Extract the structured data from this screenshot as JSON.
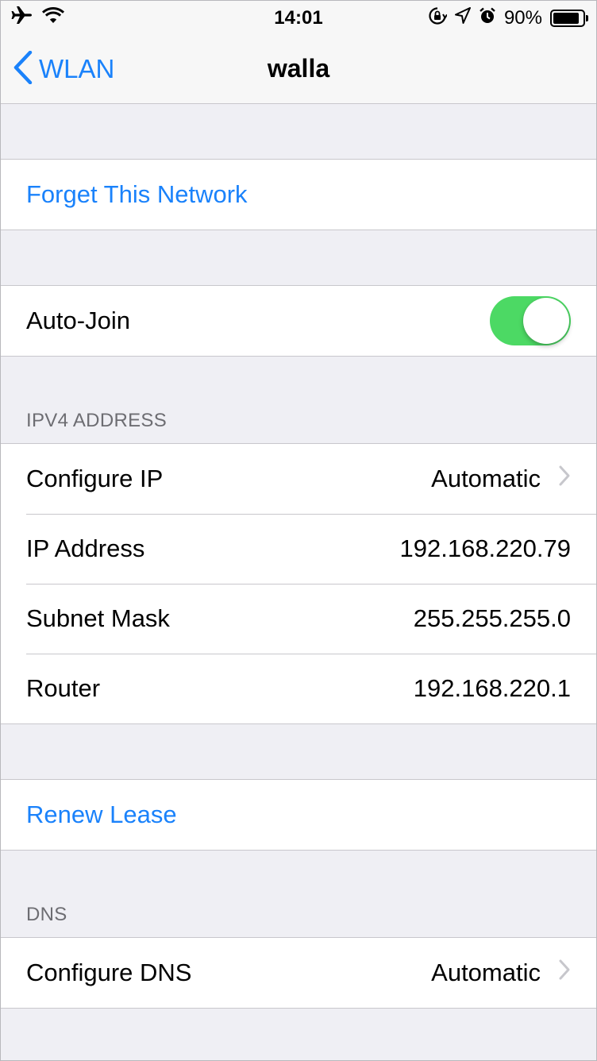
{
  "statusbar": {
    "time": "14:01",
    "battery_pct": "90%",
    "battery_level": 0.9,
    "icons_left": [
      "airplane-icon",
      "wifi-icon"
    ],
    "icons_right": [
      "orientation-lock-icon",
      "location-arrow-icon",
      "alarm-icon",
      "battery-icon"
    ]
  },
  "navbar": {
    "back_label": "WLAN",
    "title": "walla"
  },
  "forget": {
    "label": "Forget This Network"
  },
  "autojoin": {
    "label": "Auto-Join",
    "on": true
  },
  "ipv4": {
    "header": "IPV4 ADDRESS",
    "rows": [
      {
        "label": "Configure IP",
        "value": "Automatic"
      },
      {
        "label": "IP Address",
        "value": "192.168.220.79"
      },
      {
        "label": "Subnet Mask",
        "value": "255.255.255.0"
      },
      {
        "label": "Router",
        "value": "192.168.220.1"
      }
    ]
  },
  "renew": {
    "label": "Renew Lease"
  },
  "dns": {
    "header": "DNS",
    "configure_label": "Configure DNS",
    "configure_value": "Automatic"
  },
  "colors": {
    "accent": "#1a82fb",
    "toggle_on": "#4cd964",
    "background": "#efeff4",
    "separator": "#c8c7cc",
    "header_text": "#6d6d72"
  }
}
